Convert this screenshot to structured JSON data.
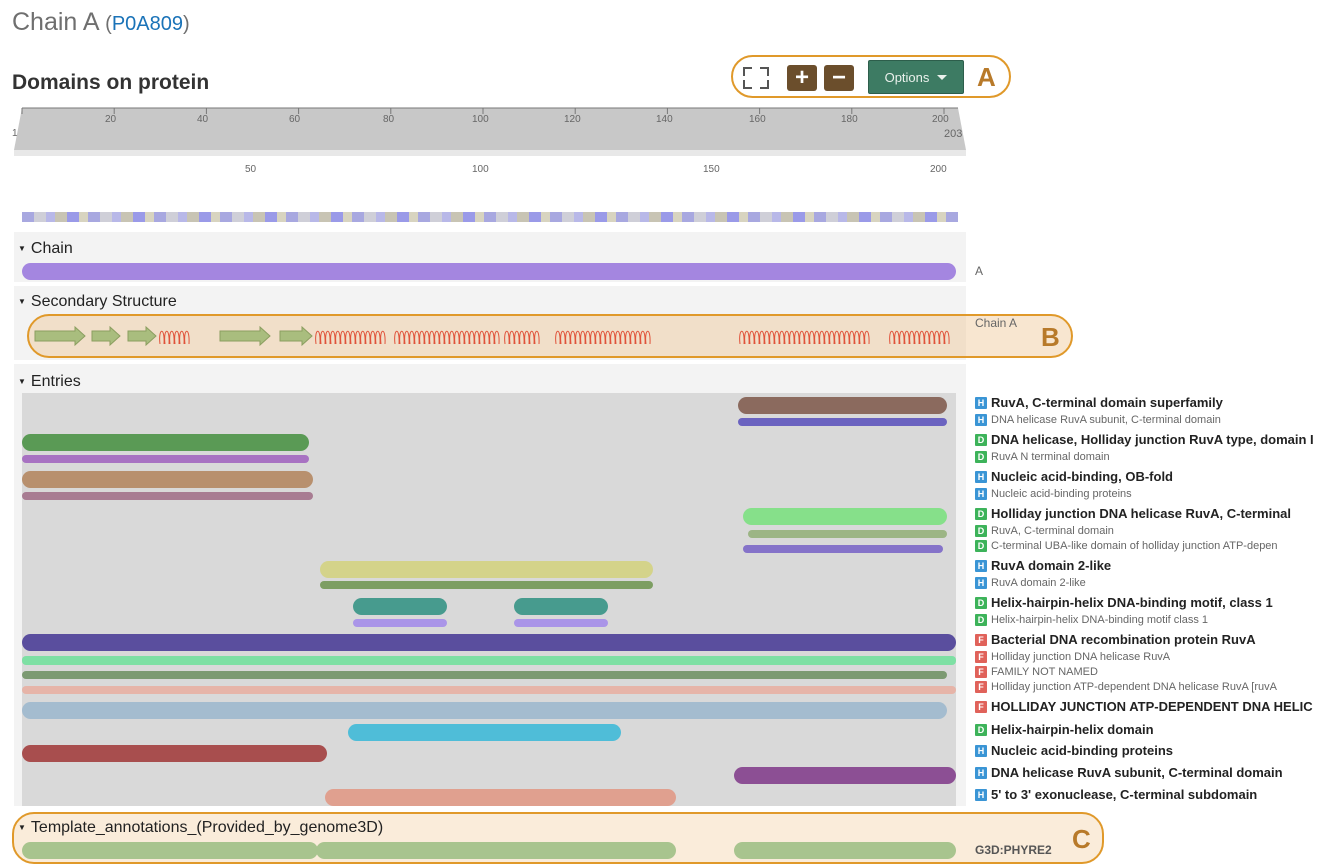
{
  "title": {
    "chain": "Chain A",
    "open_paren": "(",
    "accession": "P0A809",
    "close_paren": ")"
  },
  "heading": "Domains on protein",
  "toolbar": {
    "zoom_in_label": "+",
    "zoom_out_label": "−",
    "options_label": "Options",
    "callout": "A"
  },
  "ruler": {
    "start": "1",
    "end": "203",
    "top_ticks": [
      "20",
      "40",
      "60",
      "80",
      "100",
      "120",
      "140",
      "160",
      "180",
      "200"
    ],
    "bottom_ticks": [
      "50",
      "100",
      "150",
      "200"
    ]
  },
  "sections": {
    "chain": {
      "title": "Chain",
      "label": "A"
    },
    "secondary": {
      "title": "Secondary Structure",
      "label": "Chain A",
      "callout": "B"
    },
    "entries": {
      "title": "Entries"
    },
    "template": {
      "title": "Template_annotations_(Provided_by_genome3D)",
      "label": "G3D:PHYRE2",
      "callout": "C"
    }
  },
  "entries": [
    {
      "badge": "H",
      "name": "RuvA, C-terminal domain superfamily",
      "style": "main"
    },
    {
      "badge": "H",
      "name": "DNA helicase RuvA subunit, C-terminal domain",
      "style": "sub"
    },
    {
      "badge": "D",
      "name": "DNA helicase, Holliday junction RuvA type, domain I",
      "style": "main"
    },
    {
      "badge": "D",
      "name": "RuvA N terminal domain",
      "style": "sub"
    },
    {
      "badge": "H",
      "name": "Nucleic acid-binding, OB-fold",
      "style": "main"
    },
    {
      "badge": "H",
      "name": "Nucleic acid-binding proteins",
      "style": "sub"
    },
    {
      "badge": "D",
      "name": "Holliday junction DNA helicase RuvA, C-terminal",
      "style": "main"
    },
    {
      "badge": "D",
      "name": "RuvA, C-terminal domain",
      "style": "sub"
    },
    {
      "badge": "D",
      "name": "C-terminal UBA-like domain of holliday junction ATP-depen",
      "style": "sub"
    },
    {
      "badge": "H",
      "name": "RuvA domain 2-like",
      "style": "main"
    },
    {
      "badge": "H",
      "name": "RuvA domain 2-like",
      "style": "sub"
    },
    {
      "badge": "D",
      "name": "Helix-hairpin-helix DNA-binding motif, class 1",
      "style": "main"
    },
    {
      "badge": "D",
      "name": "Helix-hairpin-helix DNA-binding motif class 1",
      "style": "sub"
    },
    {
      "badge": "F",
      "name": "Bacterial DNA recombination protein RuvA",
      "style": "main"
    },
    {
      "badge": "F",
      "name": "Holliday junction DNA helicase RuvA",
      "style": "sub"
    },
    {
      "badge": "F",
      "name": "FAMILY NOT NAMED",
      "style": "sub"
    },
    {
      "badge": "F",
      "name": "Holliday junction ATP-dependent DNA helicase RuvA [ruvA",
      "style": "sub"
    },
    {
      "badge": "F",
      "name": "HOLLIDAY JUNCTION ATP-DEPENDENT DNA HELIC",
      "style": "main"
    },
    {
      "badge": "D",
      "name": "Helix-hairpin-helix domain",
      "style": "main"
    },
    {
      "badge": "H",
      "name": "Nucleic acid-binding proteins",
      "style": "main"
    },
    {
      "badge": "H",
      "name": "DNA helicase RuvA subunit, C-terminal domain",
      "style": "main"
    },
    {
      "badge": "H",
      "name": "5' to 3' exonuclease, C-terminal subdomain",
      "style": "main"
    }
  ],
  "colors": {
    "callout_border": "#e0992a",
    "callout_fill": "#fbe6d2",
    "zoom_buttons": "#6b4e2c",
    "options_button": "#3d7b63",
    "chain_bar": "#a486e0",
    "strand": "#a9bd7e",
    "helix": "#e0523a"
  }
}
